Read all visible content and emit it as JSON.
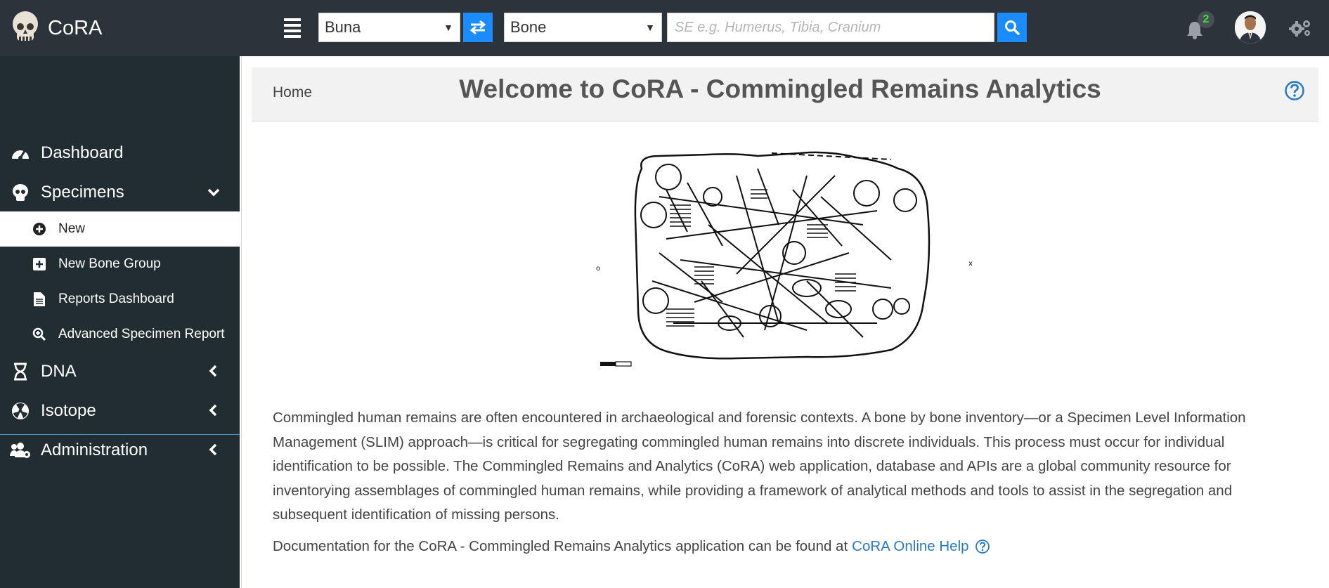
{
  "app": {
    "name": "CoRA"
  },
  "header": {
    "project_select": {
      "selected": "Buna"
    },
    "type_select": {
      "selected": "Bone"
    },
    "search": {
      "placeholder": "SE e.g. Humerus, Tibia, Cranium",
      "value": ""
    },
    "notifications_count": "2"
  },
  "sidebar": {
    "items": [
      {
        "label": "Dashboard",
        "icon": "tachometer-icon"
      },
      {
        "label": "Specimens",
        "icon": "skull-icon",
        "expanded": true,
        "children": [
          {
            "label": "New",
            "icon": "plus-circle-icon",
            "active": true
          },
          {
            "label": "New Bone Group",
            "icon": "plus-square-icon"
          },
          {
            "label": "Reports Dashboard",
            "icon": "file-icon"
          },
          {
            "label": "Advanced Specimen Report",
            "icon": "search-plus-icon"
          }
        ]
      },
      {
        "label": "DNA",
        "icon": "hourglass-icon"
      },
      {
        "label": "Isotope",
        "icon": "radiation-icon"
      },
      {
        "label": "Administration",
        "icon": "users-cog-icon"
      }
    ]
  },
  "main": {
    "breadcrumb": "Home",
    "title": "Welcome to CoRA - Commingled Remains Analytics",
    "intro": "Commingled human remains are often encountered in archaeological and forensic contexts. A bone by bone inventory—or a Specimen Level Information Management (SLIM) approach—is critical for segregating commingled human remains into discrete individuals. This process must occur for individual identification to be possible. The Commingled Remains and Analytics (CoRA) web application, database and APIs are a global community resource for inventorying assemblages of commingled human remains, while providing a framework of analytical methods and tools to assist in the segregation and subsequent identification of missing persons.",
    "doc_prefix": "Documentation for the CoRA - Commingled Remains Analytics application can be found at",
    "doc_link": "CoRA Online Help"
  },
  "colors": {
    "accent": "#1a8cff",
    "topbar": "#2b333b",
    "sidebar": "#222d32",
    "link": "#2a7ac0",
    "badge_text": "#3be23b"
  }
}
